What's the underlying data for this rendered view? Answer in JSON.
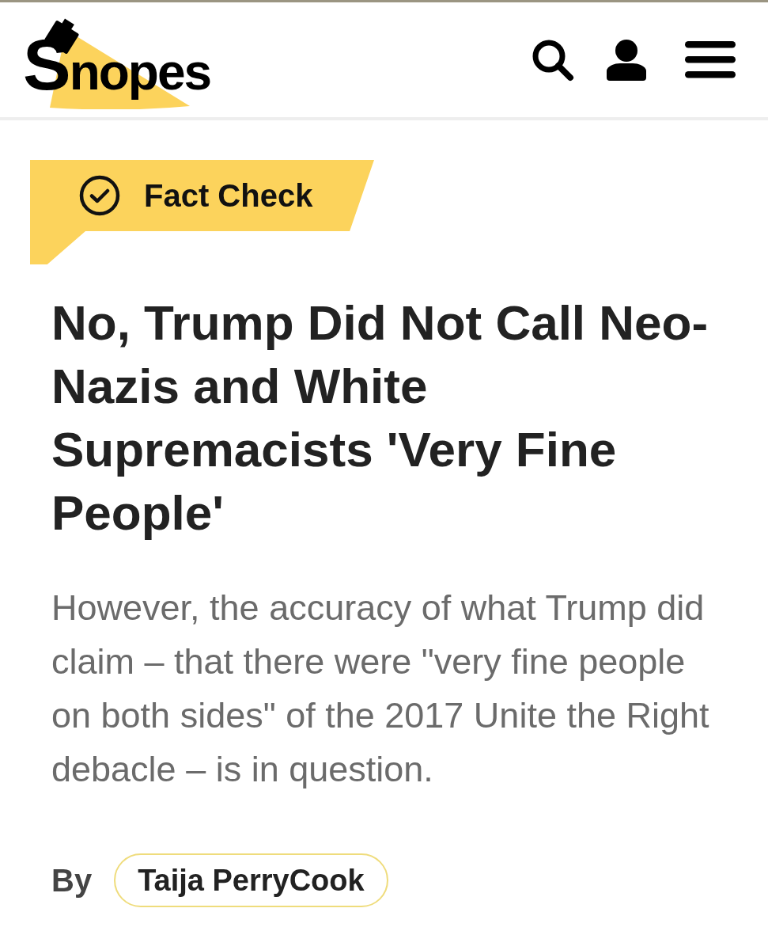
{
  "header": {
    "logo": "Snopes",
    "actions": [
      {
        "kind": "search"
      },
      {
        "kind": "account"
      },
      {
        "kind": "menu"
      }
    ]
  },
  "article": {
    "label": "Fact Check",
    "title": "No, Trump Did Not Call Neo-Nazis and White Supremacists 'Very Fine People'",
    "subtitle": "However, the accuracy of what Trump did claim – that there were \"very fine people on both sides\" of the 2017 Unite the Right debacle – is in question.",
    "byline": {
      "prefix": "By",
      "author": "Taija PerryCook"
    }
  }
}
